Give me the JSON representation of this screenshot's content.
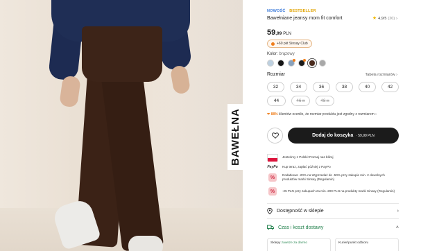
{
  "photo": {
    "badge_text": "BAWEŁNA"
  },
  "product": {
    "tag_new": "NOWOŚĆ",
    "tag_bestseller": "BESTSELLER",
    "title": "Bawełniane jeansy mom fit comfort",
    "rating_value": "4,9/5",
    "rating_count": "(20)",
    "price_main": "59",
    "price_cents": ",99",
    "currency": "PLN",
    "club_text": "+60 pkt Sinsay Club",
    "color_label": "Kolor:",
    "color_value": "brązowy",
    "swatches": [
      {
        "name": "light-blue",
        "hex": "#bdd0e0"
      },
      {
        "name": "black",
        "hex": "#151515"
      },
      {
        "name": "grey-blue",
        "hex": "#8aa2bc"
      },
      {
        "name": "dark-black",
        "hex": "#1a1a1a"
      },
      {
        "name": "brown",
        "hex": "#4a2a1c"
      },
      {
        "name": "grey",
        "hex": "#a8a8a8"
      }
    ],
    "size_label": "Rozmiar",
    "size_table_label": "Tabela rozmiarów",
    "sizes_row1": [
      "32",
      "34",
      "36",
      "38",
      "40",
      "42"
    ],
    "sizes_row2": [
      "44",
      "46",
      "48"
    ],
    "fit_pct": "88%",
    "fit_text": "klientów oceniło, że rozmiar produktu jest zgodny z rozmiarem",
    "add_to_cart_label": "Dodaj do koszyka",
    "add_to_cart_price": "· 59,99 PLN"
  },
  "info": [
    {
      "icon": "poland-flag-icon",
      "text": "Jesteśmy z Polski! Poznaj nas bliżej"
    },
    {
      "icon": "paypo-icon",
      "icon_text": "PayPo",
      "text": "Kup teraz, zapłać później z PayPo"
    },
    {
      "icon": "percent-icon",
      "icon_text": "%",
      "text": "Dodatkowe -20% na Wyprzedaż do -50% przy zakupie min. 2 dowolnych produktów marki Sinsay (Regulamin)"
    },
    {
      "icon": "percent-icon",
      "icon_text": "%",
      "text": "-25 PLN przy zakupach za min. 200 PLN na produkty marki Sinsay (Regulamin)"
    }
  ],
  "store_availability": "Dostępność w sklepie",
  "delivery": "Czas i koszt dostawy",
  "delivery_cards": [
    {
      "label": "Sklepy",
      "highlight": "zawsze za darmo"
    },
    {
      "label": "Kurier/punkt odbioru",
      "highlight": ""
    }
  ]
}
